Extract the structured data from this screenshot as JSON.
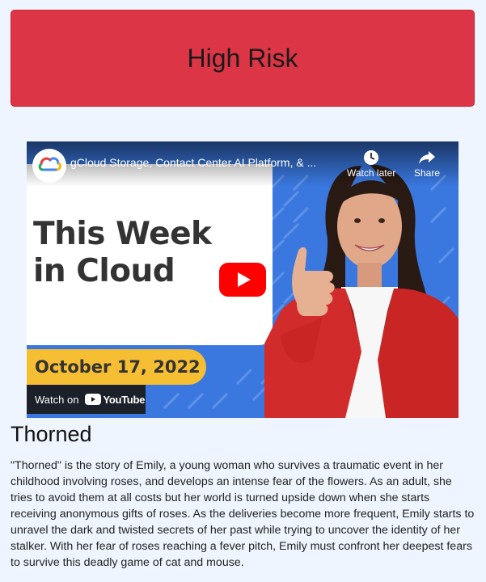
{
  "banner": {
    "label": "High Risk",
    "color": "#dc3545"
  },
  "video": {
    "title": "gCloud Storage, Contact Center AI Platform, & ...",
    "headline_line1": "This Week",
    "headline_line2": "in Cloud",
    "date": "October 17, 2022",
    "actions": {
      "watch_later": "Watch later",
      "share": "Share"
    },
    "watch_on_label": "Watch on",
    "youtube_label": "YouTube",
    "icons": {
      "channel": "google-cloud-logo-icon",
      "play": "youtube-play-icon",
      "watch_later": "clock-icon",
      "share": "share-arrow-icon"
    }
  },
  "movie": {
    "title": "Thorned",
    "description": "\"Thorned\" is the story of Emily, a young woman who survives a traumatic event in her childhood involving roses, and develops an intense fear of the flowers. As an adult, she tries to avoid them at all costs but her world is turned upside down when she starts receiving anonymous gifts of roses. As the deliveries become more frequent, Emily starts to unravel the dark and twisted secrets of her past while trying to uncover the identity of her stalker. With her fear of roses reaching a fever pitch, Emily must confront her deepest fears to survive this deadly game of cat and mouse."
  }
}
